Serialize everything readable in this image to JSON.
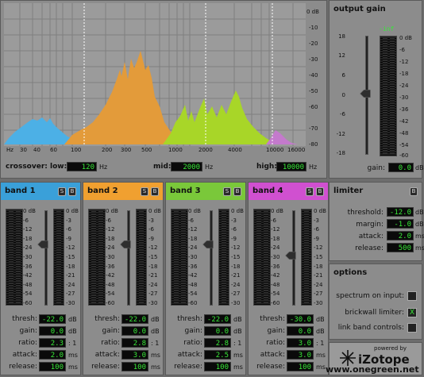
{
  "spectrum": {
    "db_labels": [
      "0 dB",
      "-10",
      "-20",
      "-30",
      "-40",
      "-50",
      "-60",
      "-70",
      "-80"
    ],
    "freq_labels": [
      "Hz",
      "30",
      "40",
      "60",
      "100",
      "200",
      "300",
      "500",
      "1000",
      "2000",
      "4000",
      "10000",
      "16000"
    ]
  },
  "crossover": {
    "label": "crossover:",
    "low_label": "low:",
    "low_value": "120",
    "low_unit": "Hz",
    "mid_label": "mid:",
    "mid_value": "2000",
    "mid_unit": "Hz",
    "high_label": "high:",
    "high_value": "10000",
    "high_unit": "Hz"
  },
  "output_gain": {
    "title": "output gain",
    "peak": "-inf",
    "scale_left": [
      "18",
      "12",
      "6",
      "0",
      "-6",
      "-12",
      "-18"
    ],
    "meter_scale": [
      "0 dB",
      "-6",
      "-12",
      "-18",
      "-24",
      "-30",
      "-36",
      "-42",
      "-48",
      "-54",
      "-60"
    ],
    "gain_label": "gain:",
    "gain_value": "0.0",
    "gain_unit": "dB"
  },
  "meter_scale_left": [
    "0 dB",
    "-6",
    "-12",
    "-18",
    "-24",
    "-30",
    "-36",
    "-42",
    "-48",
    "-54",
    "-60"
  ],
  "meter_scale_right": [
    "0 dB",
    "-3",
    "-6",
    "-9",
    "-12",
    "-15",
    "-18",
    "-21",
    "-24",
    "-27",
    "-30"
  ],
  "param_labels": {
    "thresh": "thresh:",
    "gain": "gain:",
    "ratio": "ratio:",
    "attack": "attack:",
    "release": "release:"
  },
  "units": {
    "db": "dB",
    "ratio": ": 1",
    "ms": "ms"
  },
  "btn": {
    "solo": "S",
    "bypass": "B"
  },
  "bands": [
    {
      "title": "band 1",
      "color": "#3aa0d9",
      "thresh": "-22.0",
      "gain": "0.0",
      "ratio": "2.3",
      "attack": "2.0",
      "release": "100"
    },
    {
      "title": "band 2",
      "color": "#f0a030",
      "thresh": "-22.0",
      "gain": "0.0",
      "ratio": "2.8",
      "attack": "3.0",
      "release": "100"
    },
    {
      "title": "band 3",
      "color": "#7ac83a",
      "thresh": "-22.0",
      "gain": "0.0",
      "ratio": "2.8",
      "attack": "2.5",
      "release": "100"
    },
    {
      "title": "band 4",
      "color": "#d050d0",
      "thresh": "-30.0",
      "gain": "0.0",
      "ratio": "3.0",
      "attack": "3.0",
      "release": "100"
    }
  ],
  "limiter": {
    "title": "limiter",
    "threshold_label": "threshold:",
    "threshold": "-12.0",
    "threshold_unit": "dB",
    "margin_label": "margin:",
    "margin": "-1.0",
    "margin_unit": "dB",
    "attack_label": "attack:",
    "attack": "2.0",
    "attack_unit": "ms",
    "release_label": "release:",
    "release": "500",
    "release_unit": "ms"
  },
  "options": {
    "title": "options",
    "spectrum_label": "spectrum on input:",
    "spectrum_checked": "",
    "brickwall_label": "brickwall limiter:",
    "brickwall_checked": "X",
    "link_label": "link band controls:",
    "link_checked": ""
  },
  "branding": {
    "powered": "powered by",
    "brand": "iZotope",
    "watermark": "www.onegreen.net"
  }
}
